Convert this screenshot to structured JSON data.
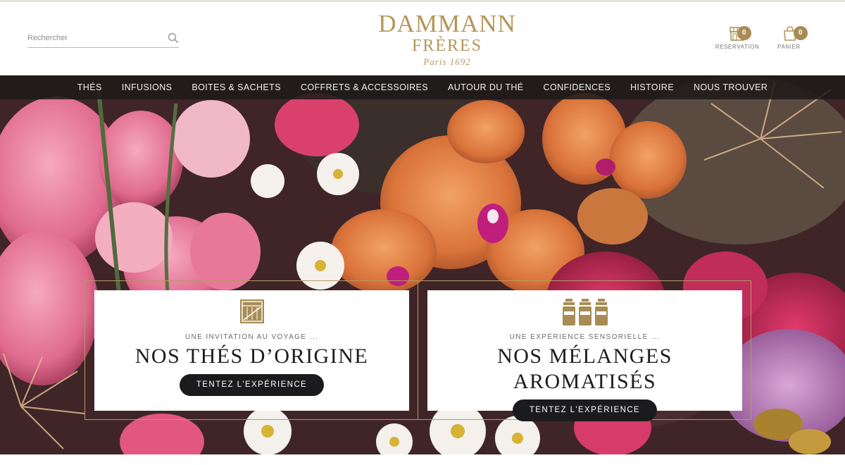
{
  "header": {
    "search_placeholder": "Rechercher",
    "logo": {
      "line1": "DAMMANN",
      "line2": "FRÈRES",
      "line3": "Paris 1692"
    },
    "reservation": {
      "label": "RESERVATION",
      "count": "0",
      "icon": "store-icon"
    },
    "cart": {
      "label": "PANIER",
      "count": "0",
      "icon": "shopping-bag-icon"
    }
  },
  "nav": {
    "items": [
      "THÉS",
      "INFUSIONS",
      "BOITES & SACHETS",
      "COFFRETS & ACCESSOIRES",
      "AUTOUR DU THÉ",
      "CONFIDENCES",
      "HISTOIRE",
      "NOUS TROUVER"
    ]
  },
  "hero": {
    "cards": [
      {
        "icon": "tea-crate-icon",
        "subtitle": "UNE INVITATION AU VOYAGE ...",
        "title": "NOS THÉS D’ORIGINE",
        "button": "TENTEZ L'EXPÉRIENCE"
      },
      {
        "icon": "tea-jars-icon",
        "subtitle": "UNE EXPÉRIENCE SENSORIELLE ...",
        "title": "NOS MÉLANGES AROMATISÉS",
        "button": "TENTEZ L'EXPÉRIENCE"
      }
    ]
  },
  "colors": {
    "gold": "#b4965a",
    "badge": "#a88c55",
    "nav_bg": "#1c1a18",
    "button_bg": "#1b1b1d"
  }
}
